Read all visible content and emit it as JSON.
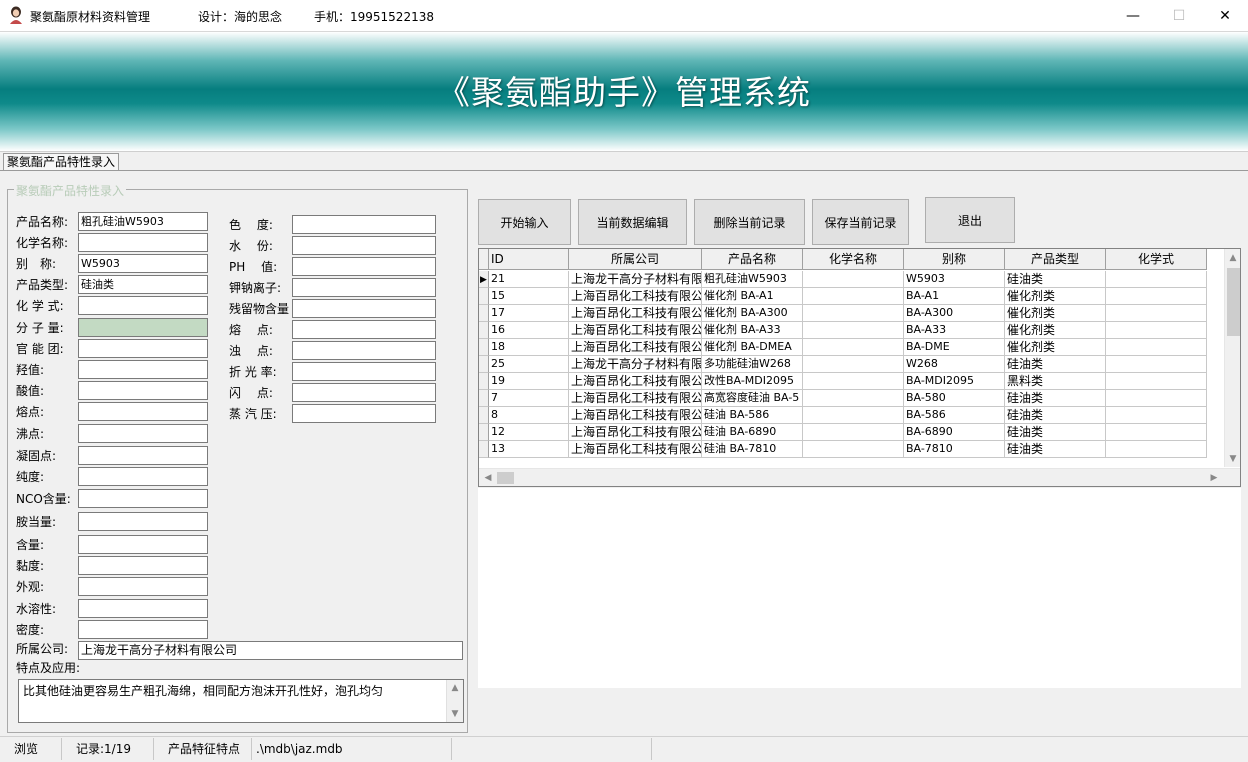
{
  "window": {
    "title": "聚氨酯原材料资料管理",
    "designer": "设计：海的思念",
    "phone": "手机：19951522138",
    "minimize": "—",
    "maximize": "☐",
    "close": "✕"
  },
  "banner": {
    "title": "《聚氨酯助手》管理系统"
  },
  "tab": {
    "label": "聚氨酯产品特性录入"
  },
  "form": {
    "legend": "聚氨酯产品特性录入",
    "left": [
      {
        "label": "产品名称:",
        "value": "粗孔硅油W5903"
      },
      {
        "label": "化学名称:",
        "value": ""
      },
      {
        "label": "别　称:",
        "value": "W5903"
      },
      {
        "label": "产品类型:",
        "value": "硅油类"
      },
      {
        "label": "化 学 式:",
        "value": ""
      },
      {
        "label": "分 子 量:",
        "value": ""
      },
      {
        "label": "官 能 团:",
        "value": ""
      },
      {
        "label": "羟值:",
        "value": ""
      },
      {
        "label": "酸值:",
        "value": ""
      },
      {
        "label": "熔点:",
        "value": ""
      },
      {
        "label": "沸点:",
        "value": ""
      },
      {
        "label": "凝固点:",
        "value": ""
      },
      {
        "label": "纯度:",
        "value": ""
      },
      {
        "label": "NCO含量:",
        "value": ""
      },
      {
        "label": "胺当量:",
        "value": ""
      },
      {
        "label": "含量:",
        "value": ""
      },
      {
        "label": "黏度:",
        "value": ""
      },
      {
        "label": "外观:",
        "value": ""
      },
      {
        "label": "水溶性:",
        "value": ""
      },
      {
        "label": "密度:",
        "value": ""
      }
    ],
    "right": [
      {
        "label": "色　 度:",
        "value": ""
      },
      {
        "label": "水　 份:",
        "value": ""
      },
      {
        "label": "PH　 值:",
        "value": ""
      },
      {
        "label": "钾钠离子:",
        "value": ""
      },
      {
        "label": "残留物含量",
        "value": ""
      },
      {
        "label": "熔　 点:",
        "value": ""
      },
      {
        "label": "浊　 点:",
        "value": ""
      },
      {
        "label": "折 光 率:",
        "value": ""
      },
      {
        "label": "闪　 点:",
        "value": ""
      },
      {
        "label": "蒸 汽 压:",
        "value": ""
      }
    ],
    "company_label": "所属公司:",
    "company_value": "上海龙干高分子材料有限公司",
    "features_label": "特点及应用:",
    "features_value": "比其他硅油更容易生产粗孔海绵，相同配方泡沫开孔性好，泡孔均匀"
  },
  "buttons": {
    "start": "开始输入",
    "edit": "当前数据编辑",
    "delete": "删除当前记录",
    "save": "保存当前记录",
    "exit": "退出"
  },
  "grid": {
    "columns": [
      "ID",
      "所属公司",
      "产品名称",
      "化学名称",
      "别称",
      "产品类型",
      "化学式"
    ],
    "rows": [
      [
        "21",
        "上海龙干高分子材料有限公司",
        "粗孔硅油W5903",
        "",
        "W5903",
        "硅油类",
        ""
      ],
      [
        "15",
        "上海百昂化工科技有限公司",
        "催化剂 BA-A1",
        "",
        "BA-A1",
        "催化剂类",
        ""
      ],
      [
        "17",
        "上海百昂化工科技有限公司",
        "催化剂 BA-A300",
        "",
        "BA-A300",
        "催化剂类",
        ""
      ],
      [
        "16",
        "上海百昂化工科技有限公司",
        "催化剂 BA-A33",
        "",
        "BA-A33",
        "催化剂类",
        ""
      ],
      [
        "18",
        "上海百昂化工科技有限公司",
        "催化剂 BA-DMEA",
        "",
        "BA-DME",
        "催化剂类",
        ""
      ],
      [
        "25",
        "上海龙干高分子材料有限公司",
        "多功能硅油W268",
        "",
        "W268",
        "硅油类",
        ""
      ],
      [
        "19",
        "上海百昂化工科技有限公司",
        "改性BA-MDI2095",
        "",
        "BA-MDI2095",
        "黑料类",
        ""
      ],
      [
        "7",
        "上海百昂化工科技有限公司",
        "高宽容度硅油 BA-5",
        "",
        "BA-580",
        "硅油类",
        ""
      ],
      [
        "8",
        "上海百昂化工科技有限公司",
        "硅油 BA-586",
        "",
        "BA-586",
        "硅油类",
        ""
      ],
      [
        "12",
        "上海百昂化工科技有限公司",
        "硅油 BA-6890",
        "",
        "BA-6890",
        "硅油类",
        ""
      ],
      [
        "13",
        "上海百昂化工科技有限公司",
        "硅油 BA-7810",
        "",
        "BA-7810",
        "硅油类",
        ""
      ]
    ],
    "selected_row_marker": "▶",
    "scroll_up": "▲",
    "scroll_down": "▼",
    "scroll_left": "◀",
    "scroll_right": "▶"
  },
  "status": {
    "mode": "浏览",
    "record": "记录:1/19",
    "info": "产品特征特点",
    "path": ".\\mdb\\jaz.mdb"
  },
  "colors": {
    "banner_teal": "#067e7f",
    "highlight_field": "#c3dac3",
    "legend_text": "#b8ccb8"
  }
}
